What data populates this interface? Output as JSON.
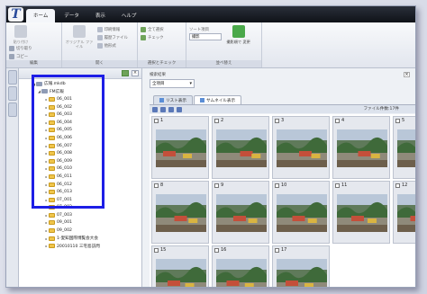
{
  "ribbon": {
    "tabs": [
      "ホーム",
      "データ",
      "表示",
      "ヘルプ"
    ],
    "groups": [
      {
        "name": "編集",
        "big": "貼り付け",
        "small": [
          "切り取り",
          "コピー",
          "削除"
        ]
      },
      {
        "name": "開く",
        "big": "オリジナル ファイル",
        "small": [
          "印刷情報",
          "履歴ファイル",
          "他形式"
        ]
      },
      {
        "name": "選択とチェック",
        "small": [
          "全て選択",
          "チェック"
        ]
      },
      {
        "name": "並べ替え",
        "label": "ソート項目",
        "value": "撮影",
        "big": "撮影順で 変更"
      }
    ]
  },
  "tree": {
    "root": "広報.mkdb",
    "child": "FM広報",
    "folders": [
      "06_001",
      "06_002",
      "06_003",
      "06_004",
      "06_005",
      "06_006",
      "06_007",
      "06_008",
      "06_009",
      "06_010",
      "06_011",
      "06_012",
      "06_013",
      "07_001",
      "07_002",
      "07_003",
      "09_001",
      "09_002",
      "1-愛知国際博覧会大会",
      "20010110 三宅島訪問"
    ]
  },
  "main": {
    "search_label": "検索結果",
    "search_value": "全項目",
    "tabs": [
      "リスト表示",
      "サムネイル表示"
    ],
    "active_tab": 1,
    "file_count": "ファイル件数:17件",
    "thumbnails": [
      "1",
      "2",
      "3",
      "4",
      "5",
      "8",
      "9",
      "10",
      "11",
      "12",
      "15",
      "16",
      "17"
    ]
  },
  "colors": {
    "highlight": "#1d1ee6",
    "folder": "#f0c54a",
    "titlebar": "#0f1217"
  }
}
